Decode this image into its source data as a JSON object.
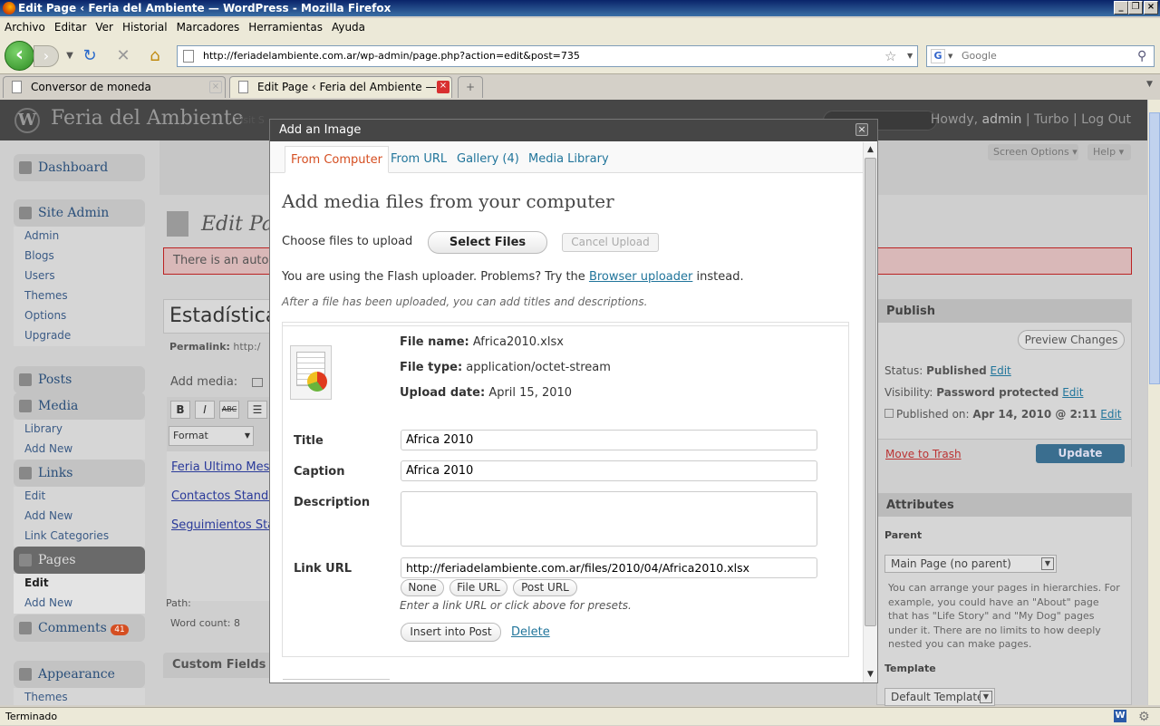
{
  "window": {
    "title": "Edit Page ‹ Feria del Ambiente — WordPress - Mozilla Firefox"
  },
  "menubar": [
    "Archivo",
    "Editar",
    "Ver",
    "Historial",
    "Marcadores",
    "Herramientas",
    "Ayuda"
  ],
  "navbar": {
    "url": "http://feriadelambiente.com.ar/wp-admin/page.php?action=edit&post=735",
    "search_placeholder": "Google"
  },
  "tabs": [
    {
      "label": "Conversor de moneda",
      "active": false
    },
    {
      "label": "Edit Page ‹ Feria del Ambiente — ...",
      "active": true
    }
  ],
  "wp": {
    "site_name": "Feria del Ambiente",
    "visit_site": "Visit S",
    "howdy": "Howdy,",
    "user": "admin",
    "turbo": "Turbo",
    "logout": "Log Out",
    "screen_options": "Screen Options",
    "help": "Help",
    "page_heading": "Edit Pa",
    "notice": "There is an auto",
    "post_title": "Estadística",
    "permalink": "Permalink: http:/",
    "add_media": "Add media:",
    "format": "Format",
    "links": [
      "Feria Ultimo Mes",
      "Contactos Stands",
      "Seguimientos Stan"
    ],
    "path": "Path:",
    "word_count": "Word count: 8",
    "custom_fields": "Custom Fields",
    "menu": {
      "dashboard": "Dashboard",
      "site_admin": "Site Admin",
      "site_admin_items": [
        "Admin",
        "Blogs",
        "Users",
        "Themes",
        "Options",
        "Upgrade"
      ],
      "posts": "Posts",
      "media": "Media",
      "media_items": [
        "Library",
        "Add New"
      ],
      "links": "Links",
      "links_items": [
        "Edit",
        "Add New",
        "Link Categories"
      ],
      "pages": "Pages",
      "pages_items": [
        "Edit",
        "Add New"
      ],
      "comments": "Comments",
      "comments_count": "41",
      "appearance": "Appearance",
      "appearance_items": [
        "Themes"
      ]
    },
    "publish": {
      "title": "Publish",
      "preview": "Preview Changes",
      "status_label": "Status:",
      "status": "Published",
      "visibility_label": "Visibility:",
      "visibility": "Password protected",
      "published_on_label": "Published on:",
      "published_on": "Apr 14, 2010 @ 2:11",
      "edit": "Edit",
      "trash": "Move to Trash",
      "update": "Update"
    },
    "attributes": {
      "title": "Attributes",
      "parent_label": "Parent",
      "parent_value": "Main Page (no parent)",
      "help": "You can arrange your pages in hierarchies. For example, you could have an \"About\" page that has \"Life Story\" and \"My Dog\" pages under it. There are no limits to how deeply nested you can make pages.",
      "template_label": "Template",
      "template_value": "Default Template"
    }
  },
  "modal": {
    "title": "Add an Image",
    "tabs": [
      "From Computer",
      "From URL",
      "Gallery (4)",
      "Media Library"
    ],
    "heading": "Add media files from your computer",
    "choose_files": "Choose files to upload",
    "select_files": "Select Files",
    "cancel_upload": "Cancel Upload",
    "flash_text_pre": "You are using the Flash uploader. Problems? Try the",
    "browser_uploader": "Browser uploader",
    "flash_text_post": "instead.",
    "after_upload": "After a file has been uploaded, you can add titles and descriptions.",
    "file": {
      "name_label": "File name:",
      "name": "Africa2010.xlsx",
      "type_label": "File type:",
      "type": "application/octet-stream",
      "date_label": "Upload date:",
      "date": "April 15, 2010"
    },
    "title_label": "Title",
    "title_value": "Africa 2010",
    "caption_label": "Caption",
    "caption_value": "Africa 2010",
    "description_label": "Description",
    "description_value": "",
    "link_label": "Link URL",
    "link_value": "http://feriadelambiente.com.ar/files/2010/04/Africa2010.xlsx",
    "presets": [
      "None",
      "File URL",
      "Post URL"
    ],
    "link_hint": "Enter a link URL or click above for presets.",
    "insert": "Insert into Post",
    "delete": "Delete"
  },
  "statusbar": {
    "text": "Terminado"
  }
}
